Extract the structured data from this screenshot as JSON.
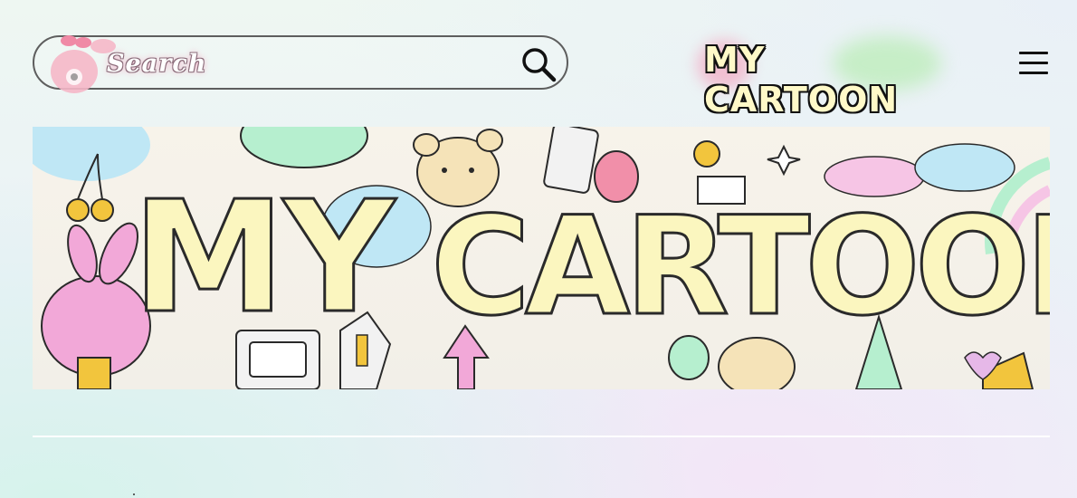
{
  "header": {
    "search": {
      "label": "Search",
      "icon": "magnifier-icon"
    },
    "logo": {
      "text": "MY CARTOON"
    },
    "menu": {
      "icon": "hamburger-menu-icon"
    }
  },
  "banner": {
    "title_left": "MY",
    "title_right": "CARTOON",
    "colors": {
      "letters": "#fbf6bf",
      "outline": "#2a2a2a",
      "pink": "#f2a8d8",
      "mint": "#b6efcf",
      "sky": "#bfe7f5"
    }
  }
}
